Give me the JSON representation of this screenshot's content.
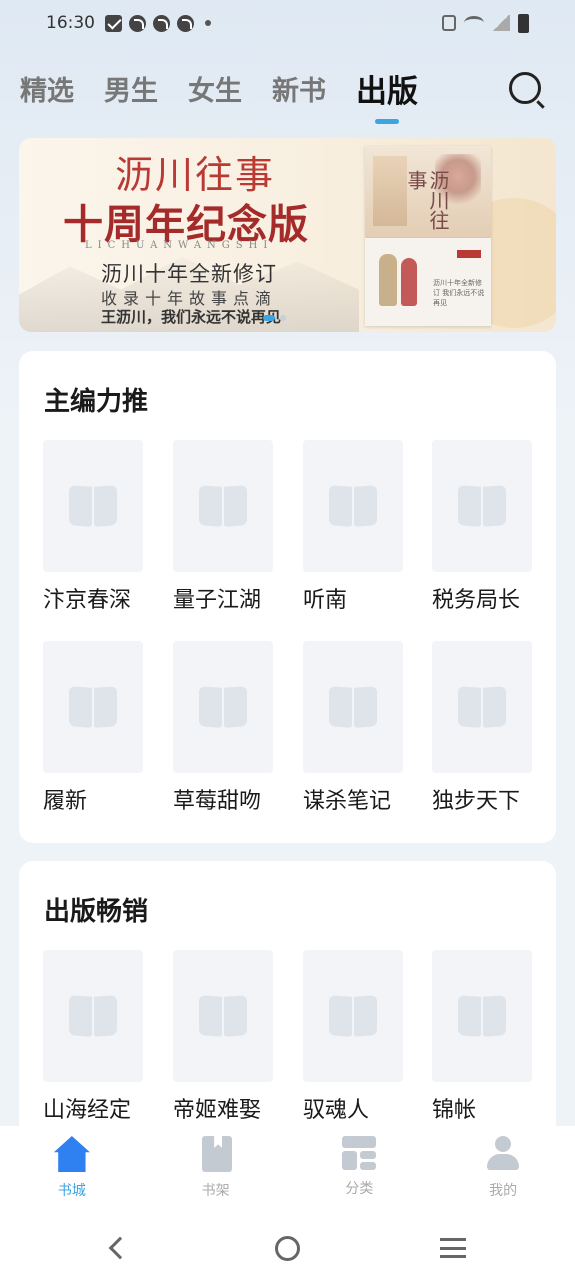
{
  "status_bar": {
    "time": "16:30",
    "icons": [
      "mail-icon",
      "notification-icon",
      "notification-icon",
      "notification-icon",
      "dot-icon",
      "vibrate-icon",
      "wifi-icon",
      "signal-icon",
      "battery-icon"
    ]
  },
  "top_tabs": [
    {
      "label": "精选",
      "active": false
    },
    {
      "label": "男生",
      "active": false
    },
    {
      "label": "女生",
      "active": false
    },
    {
      "label": "新书",
      "active": false
    },
    {
      "label": "出版",
      "active": true
    }
  ],
  "banner": {
    "title": "沥川往事",
    "subtitle": "十周年纪念版",
    "pinyin": "LICHUANWANGSHI",
    "line1": "沥川十年全新修订",
    "line2": "收录十年故事点滴",
    "line3": "王沥川，我们永远不说再见",
    "book_title": "沥川往事",
    "book2_text": "沥川十年全新修订 我们永远不说再见",
    "slide_count": 2,
    "active_slide": 1
  },
  "sections": [
    {
      "title": "主编力推",
      "books": [
        "汴京春深",
        "量子江湖",
        "听南",
        "税务局长",
        "履新",
        "草莓甜吻",
        "谋杀笔记",
        "独步天下"
      ]
    },
    {
      "title": "出版畅销",
      "books": [
        "山海经定",
        "帝姬难娶",
        "驭魂人",
        "锦帐"
      ]
    }
  ],
  "bottom_nav": [
    {
      "label": "书城",
      "icon": "home-icon",
      "active": true
    },
    {
      "label": "书架",
      "icon": "bookshelf-icon",
      "active": false
    },
    {
      "label": "分类",
      "icon": "category-icon",
      "active": false
    },
    {
      "label": "我的",
      "icon": "user-icon",
      "active": false
    }
  ],
  "colors": {
    "accent": "#3ba4e3",
    "home_icon": "#2f80f0",
    "background": "#eef3f8",
    "banner_red": "#a52a2a"
  }
}
